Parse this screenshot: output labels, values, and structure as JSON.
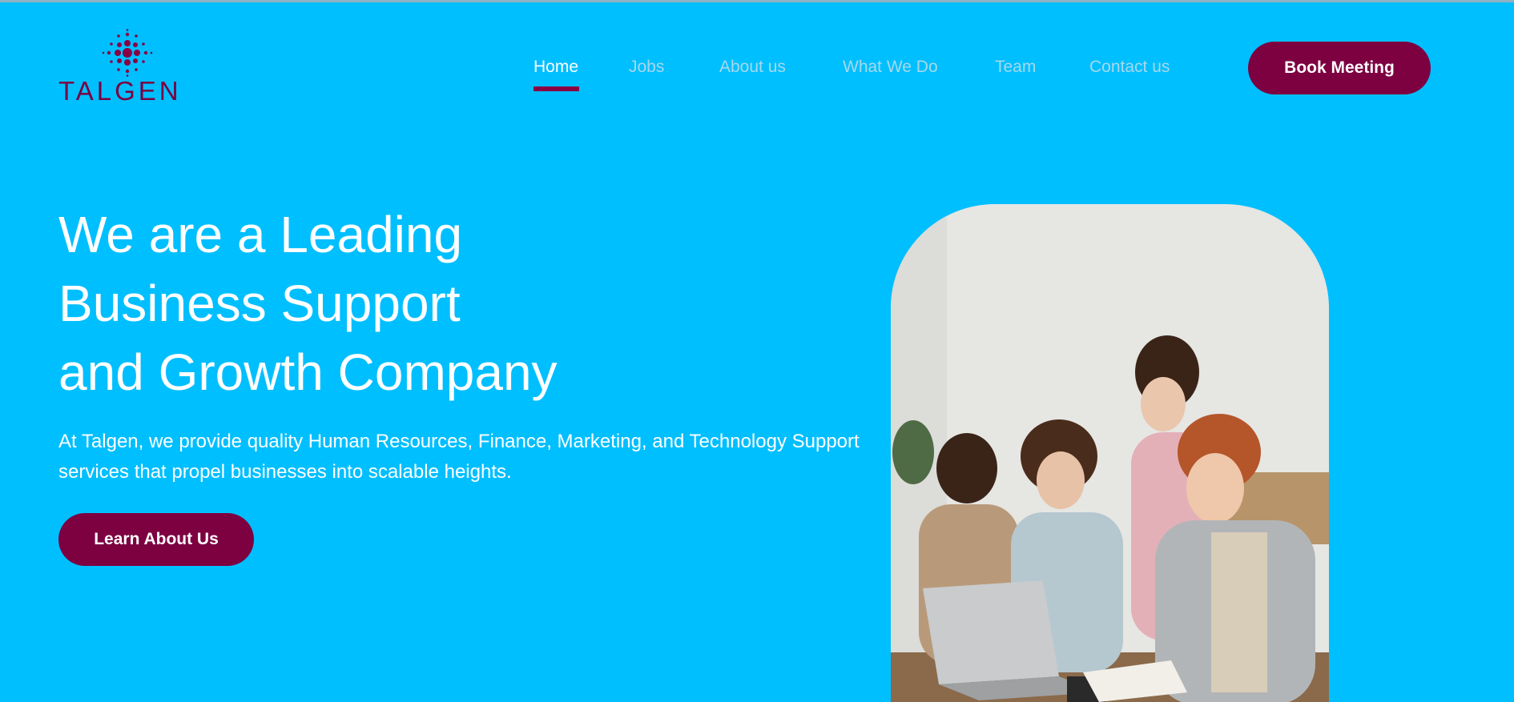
{
  "brand": {
    "name": "TALGEN",
    "color": "#7a0040"
  },
  "nav": {
    "items": [
      {
        "label": "Home",
        "active": true
      },
      {
        "label": "Jobs",
        "active": false
      },
      {
        "label": "About us",
        "active": false
      },
      {
        "label": "What We Do",
        "active": false
      },
      {
        "label": "Team",
        "active": false
      },
      {
        "label": "Contact us",
        "active": false
      }
    ],
    "cta": "Book Meeting"
  },
  "hero": {
    "title_lines": [
      "We are a Leading",
      "Business Support",
      "and Growth Company"
    ],
    "description": "At Talgen, we provide quality Human Resources, Finance, Marketing, and Technology Support services that propel businesses into scalable heights.",
    "cta": "Learn About Us",
    "image_icon": "team-meeting-photo"
  },
  "colors": {
    "background": "#00bfff",
    "accent": "#7d0041",
    "nav_inactive": "#a6d8ec"
  }
}
